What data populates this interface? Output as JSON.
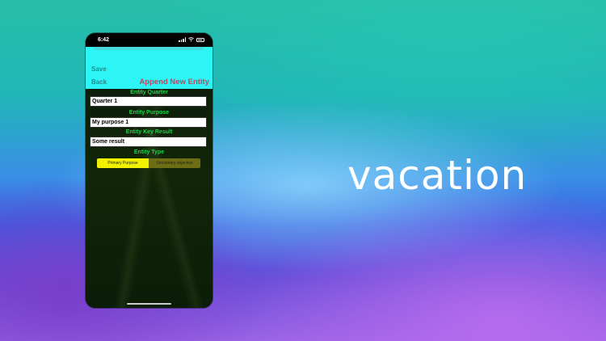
{
  "status": {
    "time": "6:42"
  },
  "nav": {
    "save": "Save",
    "back": "Back",
    "title": "Append New Entity"
  },
  "form": {
    "quarter_label": "Entity Quarter",
    "quarter_value": "Quarter 1",
    "purpose_label": "Entity Purpose",
    "purpose_value": "My purpose 1",
    "key_result_label": "Entity Key Result",
    "key_result_value": "Some result",
    "type_label": "Entity Type",
    "type_options": [
      "Primary Purpose",
      "Secondary objective"
    ],
    "type_selected": "Primary Purpose"
  },
  "tagline": "vacation",
  "colors": {
    "nav_bg": "#2ef5f5",
    "title": "#b54a63",
    "label": "#19d64a",
    "segment_selected": "#f0f000",
    "segment_unselected": "#6d6d14"
  }
}
